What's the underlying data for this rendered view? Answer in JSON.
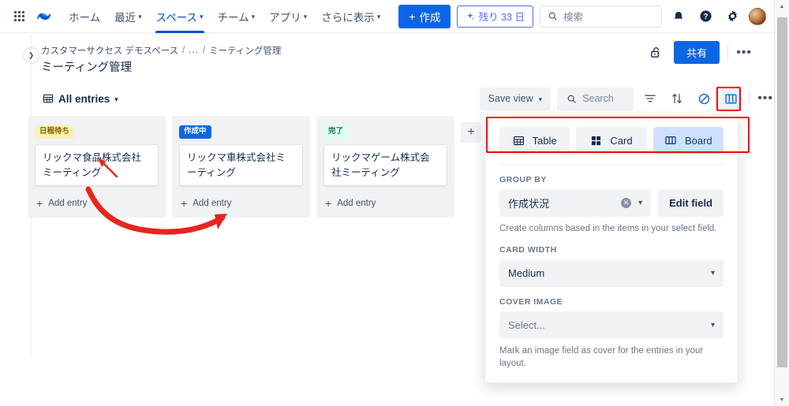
{
  "nav": {
    "app_switcher": "app-switcher",
    "logo": "confluence-logo",
    "items": [
      {
        "label": "ホーム",
        "has_chevron": false,
        "active": false
      },
      {
        "label": "最近",
        "has_chevron": true,
        "active": false
      },
      {
        "label": "スペース",
        "has_chevron": true,
        "active": true
      },
      {
        "label": "チーム",
        "has_chevron": true,
        "active": false
      },
      {
        "label": "アプリ",
        "has_chevron": true,
        "active": false
      },
      {
        "label": "さらに表示",
        "has_chevron": true,
        "active": false
      }
    ],
    "create_label": "作成",
    "trial_label": "残り 33 日",
    "search_placeholder": "検索",
    "icons": [
      "notification-bell-icon",
      "help-icon",
      "settings-gear-icon",
      "user-avatar"
    ]
  },
  "breadcrumb": {
    "space": "カスタマーサクセス デモスペース",
    "ellipsis": "...",
    "current": "ミーティング管理",
    "separator": "/"
  },
  "page": {
    "title": "ミーティング管理",
    "share_label": "共有",
    "lock_icon": "unlock-icon",
    "more_label": "•••"
  },
  "toolbar": {
    "view_name": "All entries",
    "save_view_label": "Save view",
    "search_placeholder": "Search",
    "filter_icon": "filter-icon",
    "sort_icon": "sort-icon",
    "hide_icon": "eye-off-icon",
    "board_icon": "board-layout-icon",
    "more_label": "•••"
  },
  "board": {
    "add_entry_label": "Add entry",
    "add_column_label": "+",
    "columns": [
      {
        "status": "日程待ち",
        "color": "yellow",
        "cards": [
          "リックマ食品株式会社ミーティング"
        ]
      },
      {
        "status": "作成中",
        "color": "blue",
        "cards": [
          "リックマ車株式会社ミーティング"
        ]
      },
      {
        "status": "完了",
        "color": "green",
        "cards": [
          "リックマゲーム株式会社ミーティング"
        ]
      }
    ]
  },
  "panel": {
    "view_modes": [
      {
        "label": "Table",
        "icon": "table-icon",
        "active": false
      },
      {
        "label": "Card",
        "icon": "card-grid-icon",
        "active": false
      },
      {
        "label": "Board",
        "icon": "board-columns-icon",
        "active": true
      }
    ],
    "group_by": {
      "label": "GROUP BY",
      "value": "作成状況",
      "edit_label": "Edit field",
      "hint": "Create columns based in the items in your select field."
    },
    "card_width": {
      "label": "CARD WIDTH",
      "value": "Medium"
    },
    "cover_image": {
      "label": "COVER IMAGE",
      "value": "Select...",
      "hint": "Mark an image field as cover for the entries in your layout."
    }
  },
  "colors": {
    "brand_blue": "#0C66E4",
    "accent_selected": "#CFE1FD",
    "annotation_red": "#FF0000",
    "badge_yellow_bg": "#FFF0B3",
    "badge_green_bg": "#DCFFF1",
    "panel_field_bg": "#F1F2F4"
  }
}
